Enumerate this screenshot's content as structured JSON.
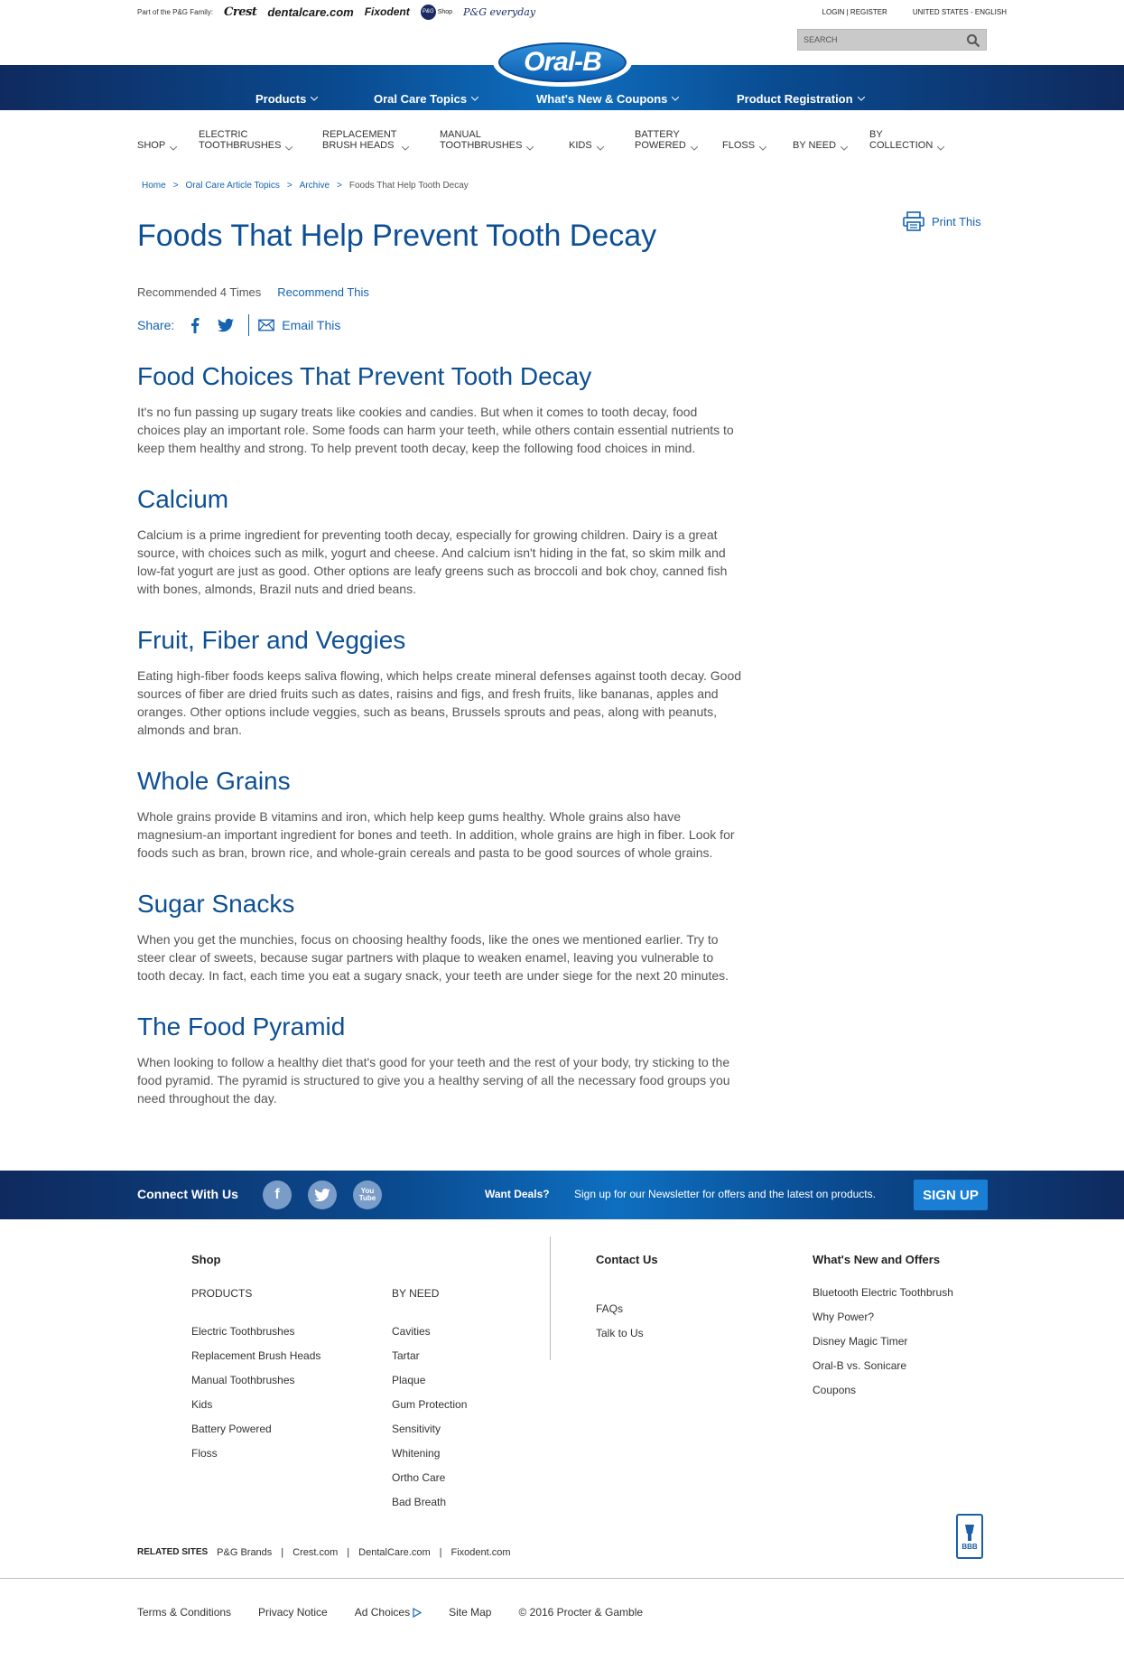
{
  "topbar": {
    "family_label": "Part of the P&G Family:",
    "brands": [
      "Crest",
      "dentalcare.com",
      "Fixodent",
      "Shop",
      "P&G everyday"
    ],
    "pg_dot": "P&G",
    "login": "LOGIN | REGISTER",
    "locale": "UNITED STATES - ENGLISH",
    "search_placeholder": "SEARCH"
  },
  "logo": {
    "text": "Oral-B"
  },
  "mainnav": [
    {
      "label": "Products"
    },
    {
      "label": "Oral Care Topics"
    },
    {
      "label": "What's New & Coupons"
    },
    {
      "label": "Product Registration"
    }
  ],
  "subnav": [
    {
      "label": "SHOP"
    },
    {
      "label": "ELECTRIC\nTOOTHBRUSHES"
    },
    {
      "label": "REPLACEMENT\nBRUSH HEADS"
    },
    {
      "label": "MANUAL\nTOOTHBRUSHES"
    },
    {
      "label": "KIDS"
    },
    {
      "label": "BATTERY\nPOWERED"
    },
    {
      "label": "FLOSS"
    },
    {
      "label": "BY NEED"
    },
    {
      "label": "BY\nCOLLECTION"
    }
  ],
  "breadcrumb": [
    "Home",
    "Oral Care Article Topics",
    "Archive",
    "Foods That Help Tooth Decay"
  ],
  "breadcrumb_sep": ">",
  "print": "Print This",
  "page_title": "Foods That Help Prevent Tooth Decay",
  "recommend": {
    "count_text": "Recommended 4 Times",
    "link": "Recommend This"
  },
  "share": {
    "label": "Share:",
    "email": "Email This"
  },
  "article": [
    {
      "heading": "Food Choices That Prevent Tooth Decay",
      "body": "It's no fun passing up sugary treats like cookies and candies. But when it comes to tooth decay, food choices play an important role. Some foods can harm your teeth, while others contain essential nutrients to keep them healthy and strong. To help prevent tooth decay, keep the following food choices in mind."
    },
    {
      "heading": "Calcium",
      "body": "Calcium is a prime ingredient for preventing tooth decay, especially for growing children. Dairy is a great source, with choices such as milk, yogurt and cheese. And calcium isn't hiding in the fat, so skim milk and low-fat yogurt are just as good. Other options are leafy greens such as broccoli and bok choy, canned fish with bones, almonds, Brazil nuts and dried beans."
    },
    {
      "heading": "Fruit, Fiber and Veggies",
      "body": "Eating high-fiber foods keeps saliva flowing, which helps create mineral defenses against tooth decay. Good sources of fiber are dried fruits such as dates, raisins and figs, and fresh fruits, like bananas, apples and oranges. Other options include veggies, such as beans, Brussels sprouts and peas, along with peanuts, almonds and bran."
    },
    {
      "heading": "Whole Grains",
      "body": "Whole grains provide B vitamins and iron, which help keep gums healthy. Whole grains also have magnesium-an important ingredient for bones and teeth. In addition, whole grains are high in fiber. Look for foods such as bran, brown rice, and whole-grain cereals and pasta to be good sources of whole grains."
    },
    {
      "heading": "Sugar Snacks",
      "body": "When you get the munchies, focus on choosing healthy foods, like the ones we mentioned earlier. Try to steer clear of sweets, because sugar partners with plaque to weaken enamel, leaving you vulnerable to tooth decay. In fact, each time you eat a sugary snack, your teeth are under siege for the next 20 minutes."
    },
    {
      "heading": "The Food Pyramid",
      "body": "When looking to follow a healthy diet that's good for your teeth and the rest of your body, try sticking to the food pyramid. The pyramid is structured to give you a healthy serving of all the necessary food groups you need throughout the day."
    }
  ],
  "footband": {
    "connect": "Connect With Us",
    "social": [
      "f",
      "t",
      "You Tube"
    ],
    "deals": "Want Deals?",
    "signup_text": "Sign up for our Newsletter for offers and the latest on products.",
    "signup_button": "SIGN UP"
  },
  "footer": {
    "shop": {
      "heading": "Shop",
      "products_label": "PRODUCTS",
      "products": [
        "Electric Toothbrushes",
        "Replacement Brush Heads",
        "Manual Toothbrushes",
        "Kids",
        "Battery Powered",
        "Floss"
      ],
      "byneed_label": "BY NEED",
      "byneed": [
        "Cavities",
        "Tartar",
        "Plaque",
        "Gum Protection",
        "Sensitivity",
        "Whitening",
        "Ortho Care",
        "Bad Breath"
      ]
    },
    "contact": {
      "heading": "Contact Us",
      "links": [
        "FAQs",
        "Talk to Us"
      ]
    },
    "whatsnew": {
      "heading": "What's New and Offers",
      "links": [
        "Bluetooth Electric Toothbrush",
        "Why Power?",
        "Disney Magic Timer",
        "Oral-B vs. Sonicare",
        "Coupons"
      ]
    }
  },
  "related": {
    "label": "RELATED SITES",
    "links": [
      "P&G Brands",
      "Crest.com",
      "DentalCare.com",
      "Fixodent.com"
    ],
    "sep": "|"
  },
  "bbb": "BBB",
  "legal": [
    "Terms & Conditions",
    "Privacy Notice",
    "Ad Choices",
    "Site Map",
    "© 2016 Procter & Gamble"
  ],
  "colors": {
    "brand_blue": "#0d4f94",
    "link_blue": "#1463b0",
    "nav_dark": "#0f2a5e",
    "signup": "#1a7fd4"
  }
}
